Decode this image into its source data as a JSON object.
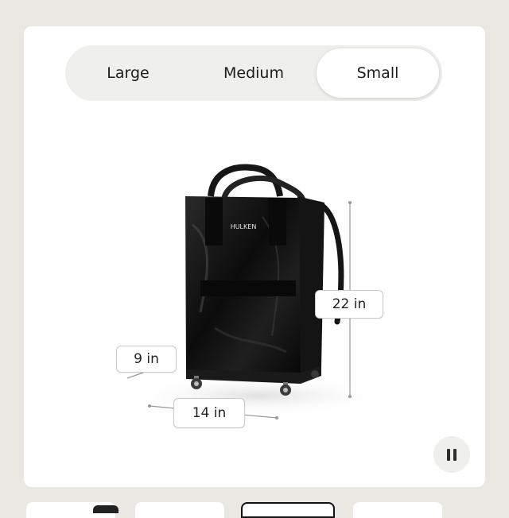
{
  "size_selector": {
    "options": [
      {
        "label": "Large",
        "selected": false
      },
      {
        "label": "Medium",
        "selected": false
      },
      {
        "label": "Small",
        "selected": true
      }
    ]
  },
  "product": {
    "brand": "HULKEN",
    "color": "#111111"
  },
  "dimensions": {
    "height": "22 in",
    "depth": "9 in",
    "width": "14 in"
  },
  "media_controls": {
    "state": "playing",
    "icon": "pause-icon"
  },
  "thumbnails": {
    "count": 4,
    "selected_index": 2
  }
}
